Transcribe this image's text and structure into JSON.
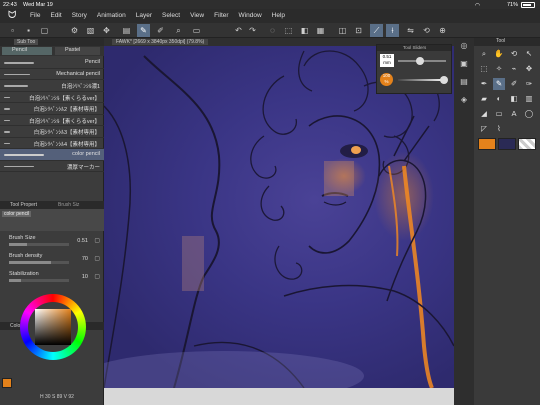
{
  "status": {
    "time": "22:43",
    "date": "Wed Mar 19",
    "battery": "71%"
  },
  "menu": [
    "File",
    "Edit",
    "Story",
    "Animation",
    "Layer",
    "Select",
    "View",
    "Filter",
    "Window",
    "Help"
  ],
  "subtool": {
    "header": "Sub Too",
    "tabs": [
      "Pencil",
      "Pastel"
    ],
    "brushes": [
      {
        "name": "Pencil"
      },
      {
        "name": "Mechanical pencil"
      },
      {
        "name": "白泡ｼﾘﾍﾟﾝｼﾙ濃1"
      },
      {
        "name": "白泡ｼﾘﾍﾟﾝｼﾙ【素くらるver】"
      },
      {
        "name": "白泡ｼﾘﾍﾟﾝｼﾙ2【素材専用】"
      },
      {
        "name": "白泡ｼﾘﾍﾟﾝｼﾙ【素くらるver】"
      },
      {
        "name": "白泡ｼﾘﾍﾟﾝｼﾙ3【素材専用】"
      },
      {
        "name": "白泡ｼﾘﾍﾟﾝｼﾙ4【素材専用】"
      },
      {
        "name": "color pencil"
      },
      {
        "name": "濃厚マーカー"
      }
    ],
    "selected_index": 8
  },
  "tool_property": {
    "header": "Tool Propert",
    "header2": "Brush Siz",
    "preview_label": "color pencil",
    "rows": [
      {
        "label": "Brush Size",
        "value": "0.51",
        "level": 0.3
      },
      {
        "label": "Brush density",
        "value": "70",
        "level": 0.7
      },
      {
        "label": "Stabilization",
        "value": "10",
        "level": 0.2
      }
    ]
  },
  "color_wheel": {
    "header": "Color Wheel",
    "main_color": "#e4821b",
    "h": "30",
    "s": "89",
    "v": "92"
  },
  "canvas": {
    "title": "FAWK* [2669 x 3840px 350dpi] (79.8%)"
  },
  "tool_slider": {
    "header": "Tool Sliders",
    "size_value": "0.51",
    "size_unit": "mm",
    "size_level": 0.45,
    "opacity_value": "100",
    "opacity_unit": "%",
    "opacity_level": 1.0
  },
  "tool_panel": {
    "header": "Tool"
  },
  "swatches": [
    "#e4821b",
    "#2a2a55",
    "checker"
  ]
}
